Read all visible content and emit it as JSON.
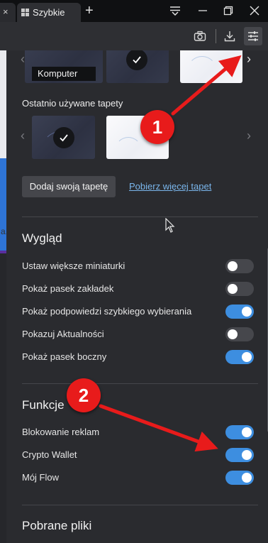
{
  "tabs": {
    "active_title": "Szybkie",
    "new_tab_symbol": "+"
  },
  "wallpapers": {
    "computer_label": "Komputer",
    "recent_title": "Ostatnio używane tapety",
    "add_button": "Dodaj swoją tapetę",
    "more_link": "Pobierz więcej tapet"
  },
  "appearance": {
    "title": "Wygląd",
    "items": [
      {
        "label": "Ustaw większe miniaturki",
        "on": false
      },
      {
        "label": "Pokaż pasek zakładek",
        "on": false
      },
      {
        "label": "Pokaż podpowiedzi szybkiego wybierania",
        "on": true
      },
      {
        "label": "Pokazuj Aktualności",
        "on": false
      },
      {
        "label": "Pokaż pasek boczny",
        "on": true
      }
    ]
  },
  "features": {
    "title": "Funkcje",
    "items": [
      {
        "label": "Blokowanie reklam",
        "on": true
      },
      {
        "label": "Crypto Wallet",
        "on": true
      },
      {
        "label": "Mój Flow",
        "on": true
      }
    ]
  },
  "downloads": {
    "title": "Pobrane pliki"
  },
  "left_edge_text": "a.",
  "annotations": {
    "badge1": "1",
    "badge2": "2",
    "color": "#e81b1b"
  },
  "colors": {
    "accent": "#3d8ee0",
    "panel": "#2a2b2f",
    "toolbar": "#2e2f33"
  }
}
